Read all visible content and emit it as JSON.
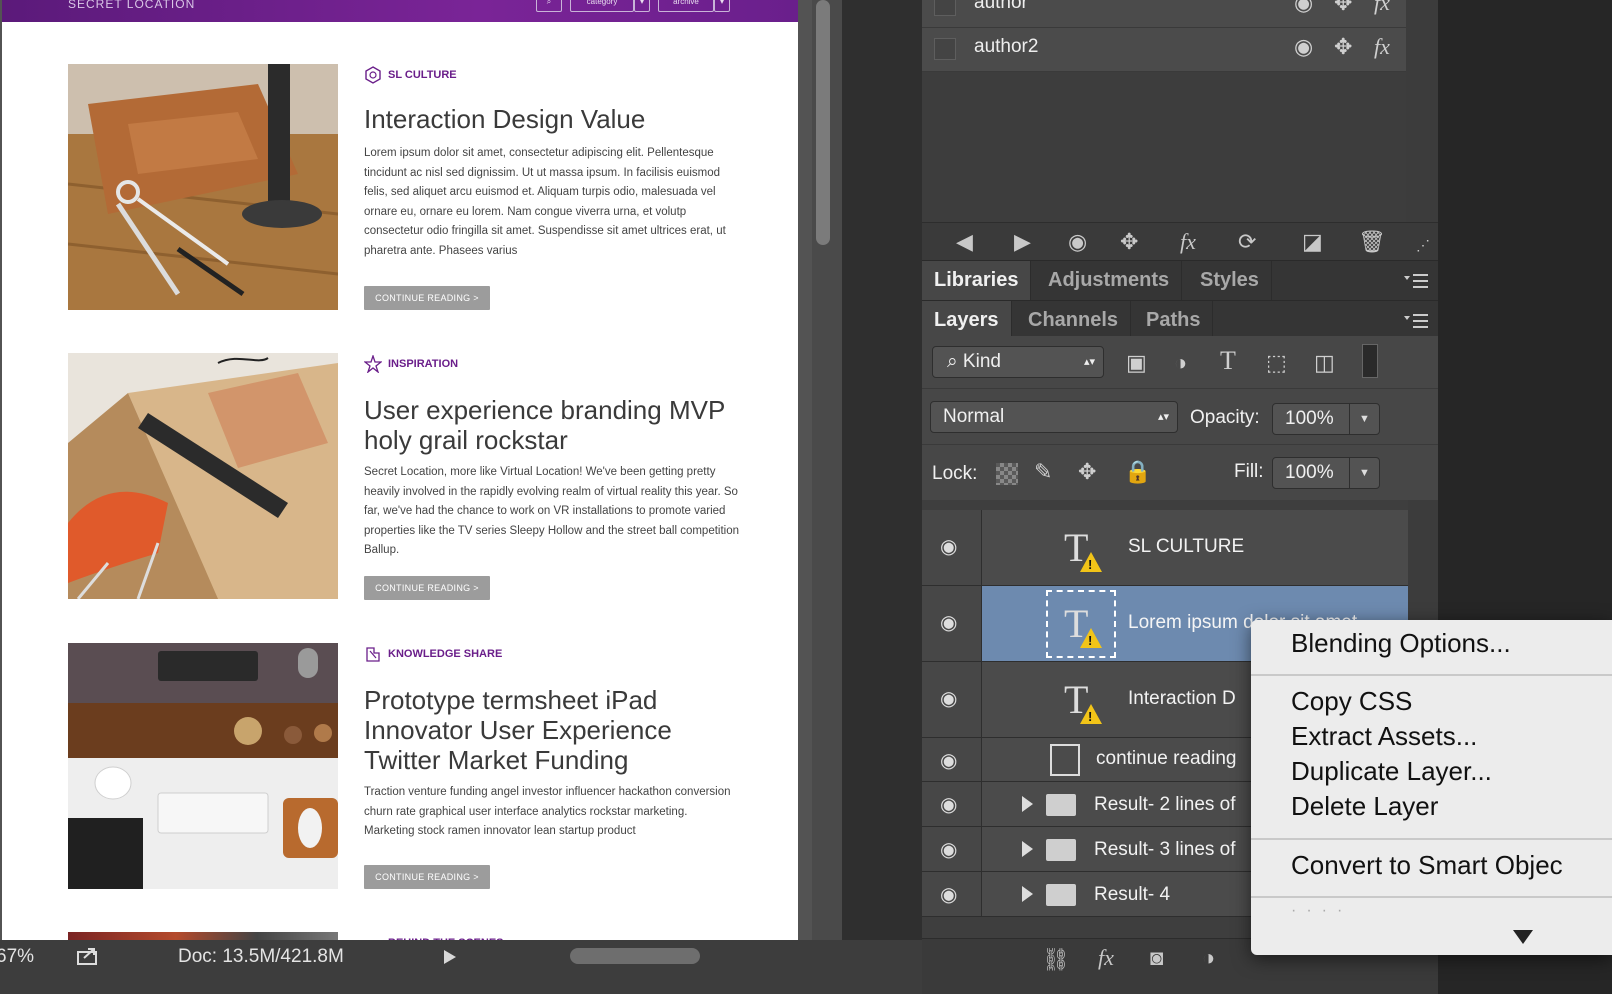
{
  "document": {
    "brand": "SECRET LOCATION",
    "header_controls": [
      "",
      "category",
      "",
      "archive",
      ""
    ],
    "articles": [
      {
        "category": "SL CULTURE",
        "title": "Interaction Design Value",
        "body": "Lorem ipsum dolor sit amet, consectetur adipiscing elit. Pellentesque tincidunt ac nisl sed dignissim. Ut ut massa ipsum. In facilisis euismod felis, sed aliquet arcu euismod et. Aliquam turpis odio, malesuada vel ornare eu, ornare eu lorem. Nam congue viverra urna, et volutp consectetur odio fringilla sit amet. Suspendisse sit amet ultrices erat, ut pharetra ante. Phasees varius",
        "button": "CONTINUE READING >"
      },
      {
        "category": "INSPIRATION",
        "title": "User experience branding MVP holy grail rockstar",
        "body": "Secret Location, more like Virtual Location! We've been getting pretty heavily involved in the rapidly evolving realm of virtual reality this year. So far, we've had the chance to work on VR installations to promote varied properties like the TV series Sleepy Hollow and the street ball competition Ballup.",
        "button": "CONTINUE READING >"
      },
      {
        "category": "KNOWLEDGE SHARE",
        "title": "Prototype termsheet iPad Innovator User Experience Twitter Market Funding",
        "body": "Traction venture funding angel investor influencer hackathon conversion churn rate graphical user interface analytics rockstar marketing. Marketing stock ramen innovator lean startup product",
        "button": "CONTINUE READING >"
      }
    ],
    "next_category": "BEHIND THE SCENES"
  },
  "status_bar": {
    "zoom": "67%",
    "doc_size": "Doc: 13.5M/421.8M"
  },
  "styles_panel": {
    "rows": [
      {
        "label": "author"
      },
      {
        "label": "author2"
      }
    ]
  },
  "panel_tabs_top": [
    "Libraries",
    "Adjustments",
    "Styles"
  ],
  "panel_tabs_layers": [
    "Layers",
    "Channels",
    "Paths"
  ],
  "layers_panel": {
    "filter_kind": "Kind",
    "blend_mode": "Normal",
    "opacity_label": "Opacity:",
    "opacity_value": "100%",
    "lock_label": "Lock:",
    "fill_label": "Fill:",
    "fill_value": "100%",
    "layers": [
      {
        "name": "SL CULTURE",
        "type": "text",
        "selected": false
      },
      {
        "name": "Lorem ipsum dolor sit amet",
        "type": "text",
        "selected": true
      },
      {
        "name": "Interaction D",
        "type": "text",
        "selected": false
      },
      {
        "name": "continue reading",
        "type": "smart",
        "selected": false
      },
      {
        "name": "Result- 2 lines of",
        "type": "group",
        "selected": false
      },
      {
        "name": "Result- 3 lines of",
        "type": "group",
        "selected": false
      },
      {
        "name": "Result- 4",
        "type": "group",
        "selected": false
      }
    ]
  },
  "context_menu": {
    "items": [
      "Blending Options...",
      "Copy CSS",
      "Extract Assets...",
      "Duplicate Layer...",
      "Delete Layer",
      "Convert to Smart Objec"
    ]
  },
  "colors": {
    "accent_purple": "#6a1e8a",
    "selection_blue": "#6d8aaf",
    "warning_yellow": "#f2c418"
  }
}
